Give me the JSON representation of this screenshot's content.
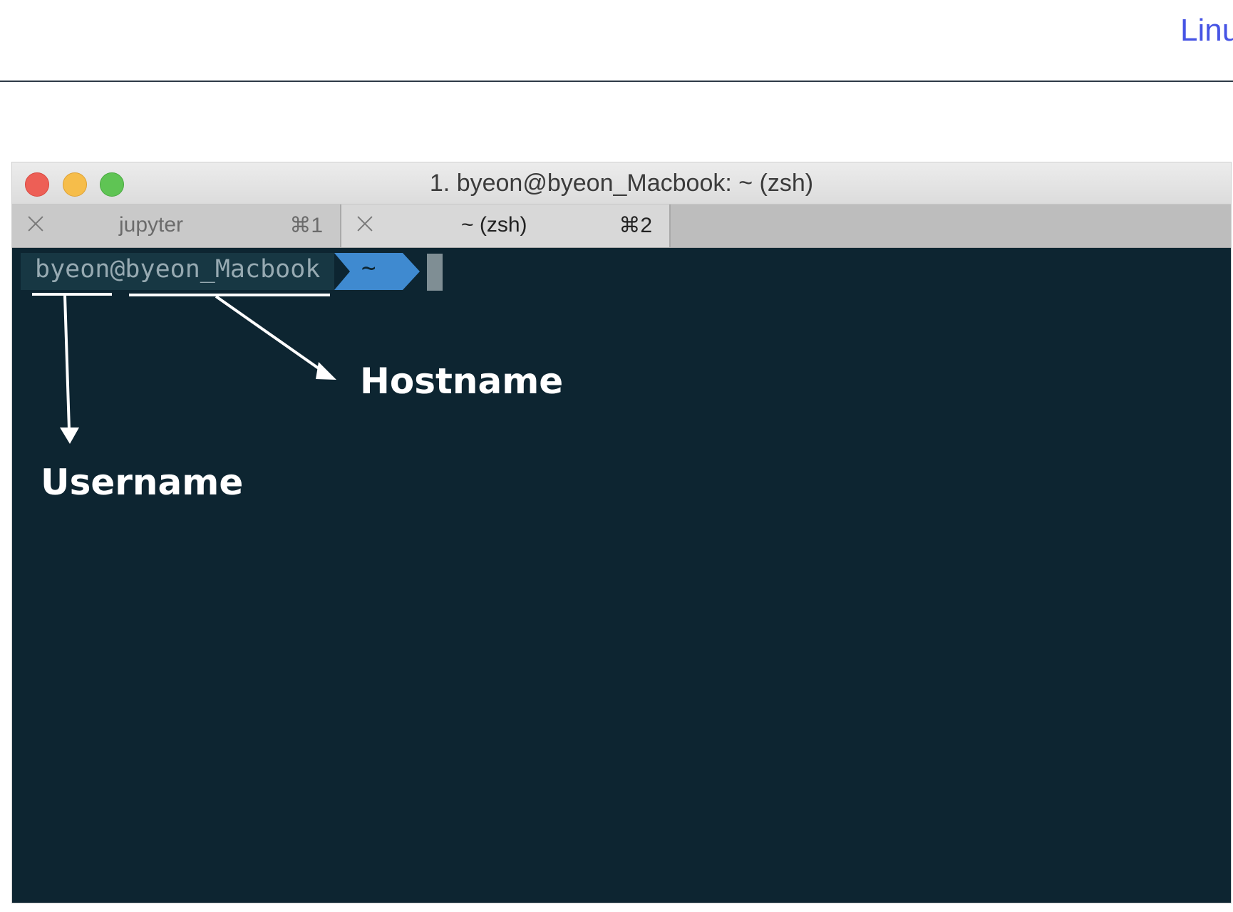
{
  "header": {
    "nav_link": "Linux"
  },
  "window": {
    "title": "1. byeon@byeon_Macbook: ~ (zsh)",
    "tabs": [
      {
        "label": "jupyter",
        "shortcut": "⌘1",
        "active": false
      },
      {
        "label": "~ (zsh)",
        "shortcut": "⌘2",
        "active": true
      }
    ]
  },
  "terminal": {
    "prompt_user_host": "byeon@byeon_Macbook",
    "prompt_dir": "~",
    "colors": {
      "background": "#0d2531",
      "segment": "#173743",
      "dir_segment": "#3f8ad0"
    }
  },
  "annotations": {
    "hostname_label": "Hostname",
    "username_label": "Username"
  }
}
